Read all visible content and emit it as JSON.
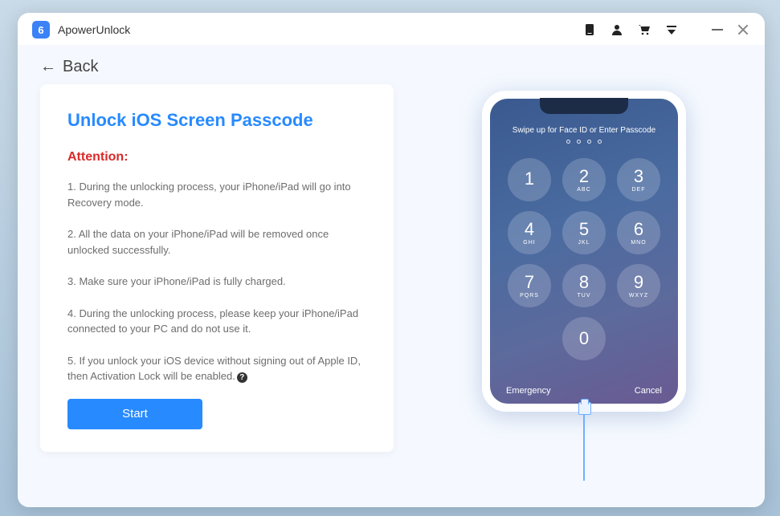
{
  "app": {
    "name": "ApowerUnlock",
    "icon_glyph": "6"
  },
  "nav": {
    "back_label": "Back"
  },
  "main": {
    "title": "Unlock iOS Screen Passcode",
    "attention_label": "Attention:",
    "notes": [
      "1. During the unlocking process, your iPhone/iPad will go into Recovery mode.",
      "2. All the data on your iPhone/iPad will be removed once unlocked successfully.",
      "3. Make sure your iPhone/iPad is fully charged.",
      "4. During the unlocking process, please keep your iPhone/iPad connected to your PC and do not use it.",
      "5. If you unlock your iOS device without signing out of Apple ID, then Activation Lock will be enabled."
    ],
    "info_glyph": "?",
    "start_label": "Start"
  },
  "phone": {
    "swipe_text": "Swipe up for Face ID or Enter Passcode",
    "emergency_label": "Emergency",
    "cancel_label": "Cancel",
    "keys": [
      {
        "n": "1",
        "l": ""
      },
      {
        "n": "2",
        "l": "ABC"
      },
      {
        "n": "3",
        "l": "DEF"
      },
      {
        "n": "4",
        "l": "GHI"
      },
      {
        "n": "5",
        "l": "JKL"
      },
      {
        "n": "6",
        "l": "MNO"
      },
      {
        "n": "7",
        "l": "PQRS"
      },
      {
        "n": "8",
        "l": "TUV"
      },
      {
        "n": "9",
        "l": "WXYZ"
      },
      {
        "n": "0",
        "l": ""
      }
    ]
  }
}
